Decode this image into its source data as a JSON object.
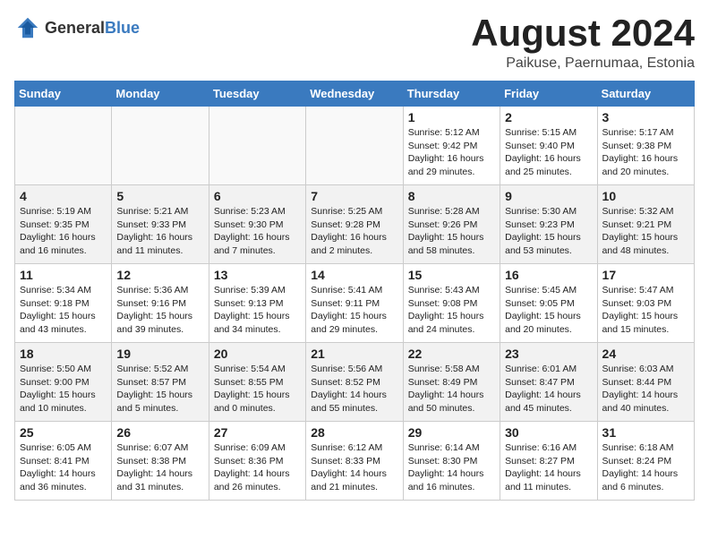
{
  "header": {
    "logo_general": "General",
    "logo_blue": "Blue",
    "month_title": "August 2024",
    "location": "Paikuse, Paernumaa, Estonia"
  },
  "days_of_week": [
    "Sunday",
    "Monday",
    "Tuesday",
    "Wednesday",
    "Thursday",
    "Friday",
    "Saturday"
  ],
  "weeks": [
    [
      {
        "day": "",
        "empty": true
      },
      {
        "day": "",
        "empty": true
      },
      {
        "day": "",
        "empty": true
      },
      {
        "day": "",
        "empty": true
      },
      {
        "day": "1",
        "sunrise": "5:12 AM",
        "sunset": "9:42 PM",
        "daylight": "16 hours and 29 minutes."
      },
      {
        "day": "2",
        "sunrise": "5:15 AM",
        "sunset": "9:40 PM",
        "daylight": "16 hours and 25 minutes."
      },
      {
        "day": "3",
        "sunrise": "5:17 AM",
        "sunset": "9:38 PM",
        "daylight": "16 hours and 20 minutes."
      }
    ],
    [
      {
        "day": "4",
        "sunrise": "5:19 AM",
        "sunset": "9:35 PM",
        "daylight": "16 hours and 16 minutes."
      },
      {
        "day": "5",
        "sunrise": "5:21 AM",
        "sunset": "9:33 PM",
        "daylight": "16 hours and 11 minutes."
      },
      {
        "day": "6",
        "sunrise": "5:23 AM",
        "sunset": "9:30 PM",
        "daylight": "16 hours and 7 minutes."
      },
      {
        "day": "7",
        "sunrise": "5:25 AM",
        "sunset": "9:28 PM",
        "daylight": "16 hours and 2 minutes."
      },
      {
        "day": "8",
        "sunrise": "5:28 AM",
        "sunset": "9:26 PM",
        "daylight": "15 hours and 58 minutes."
      },
      {
        "day": "9",
        "sunrise": "5:30 AM",
        "sunset": "9:23 PM",
        "daylight": "15 hours and 53 minutes."
      },
      {
        "day": "10",
        "sunrise": "5:32 AM",
        "sunset": "9:21 PM",
        "daylight": "15 hours and 48 minutes."
      }
    ],
    [
      {
        "day": "11",
        "sunrise": "5:34 AM",
        "sunset": "9:18 PM",
        "daylight": "15 hours and 43 minutes."
      },
      {
        "day": "12",
        "sunrise": "5:36 AM",
        "sunset": "9:16 PM",
        "daylight": "15 hours and 39 minutes."
      },
      {
        "day": "13",
        "sunrise": "5:39 AM",
        "sunset": "9:13 PM",
        "daylight": "15 hours and 34 minutes."
      },
      {
        "day": "14",
        "sunrise": "5:41 AM",
        "sunset": "9:11 PM",
        "daylight": "15 hours and 29 minutes."
      },
      {
        "day": "15",
        "sunrise": "5:43 AM",
        "sunset": "9:08 PM",
        "daylight": "15 hours and 24 minutes."
      },
      {
        "day": "16",
        "sunrise": "5:45 AM",
        "sunset": "9:05 PM",
        "daylight": "15 hours and 20 minutes."
      },
      {
        "day": "17",
        "sunrise": "5:47 AM",
        "sunset": "9:03 PM",
        "daylight": "15 hours and 15 minutes."
      }
    ],
    [
      {
        "day": "18",
        "sunrise": "5:50 AM",
        "sunset": "9:00 PM",
        "daylight": "15 hours and 10 minutes."
      },
      {
        "day": "19",
        "sunrise": "5:52 AM",
        "sunset": "8:57 PM",
        "daylight": "15 hours and 5 minutes."
      },
      {
        "day": "20",
        "sunrise": "5:54 AM",
        "sunset": "8:55 PM",
        "daylight": "15 hours and 0 minutes."
      },
      {
        "day": "21",
        "sunrise": "5:56 AM",
        "sunset": "8:52 PM",
        "daylight": "14 hours and 55 minutes."
      },
      {
        "day": "22",
        "sunrise": "5:58 AM",
        "sunset": "8:49 PM",
        "daylight": "14 hours and 50 minutes."
      },
      {
        "day": "23",
        "sunrise": "6:01 AM",
        "sunset": "8:47 PM",
        "daylight": "14 hours and 45 minutes."
      },
      {
        "day": "24",
        "sunrise": "6:03 AM",
        "sunset": "8:44 PM",
        "daylight": "14 hours and 40 minutes."
      }
    ],
    [
      {
        "day": "25",
        "sunrise": "6:05 AM",
        "sunset": "8:41 PM",
        "daylight": "14 hours and 36 minutes."
      },
      {
        "day": "26",
        "sunrise": "6:07 AM",
        "sunset": "8:38 PM",
        "daylight": "14 hours and 31 minutes."
      },
      {
        "day": "27",
        "sunrise": "6:09 AM",
        "sunset": "8:36 PM",
        "daylight": "14 hours and 26 minutes."
      },
      {
        "day": "28",
        "sunrise": "6:12 AM",
        "sunset": "8:33 PM",
        "daylight": "14 hours and 21 minutes."
      },
      {
        "day": "29",
        "sunrise": "6:14 AM",
        "sunset": "8:30 PM",
        "daylight": "14 hours and 16 minutes."
      },
      {
        "day": "30",
        "sunrise": "6:16 AM",
        "sunset": "8:27 PM",
        "daylight": "14 hours and 11 minutes."
      },
      {
        "day": "31",
        "sunrise": "6:18 AM",
        "sunset": "8:24 PM",
        "daylight": "14 hours and 6 minutes."
      }
    ]
  ],
  "labels": {
    "sunrise": "Sunrise:",
    "sunset": "Sunset:",
    "daylight": "Daylight:"
  }
}
